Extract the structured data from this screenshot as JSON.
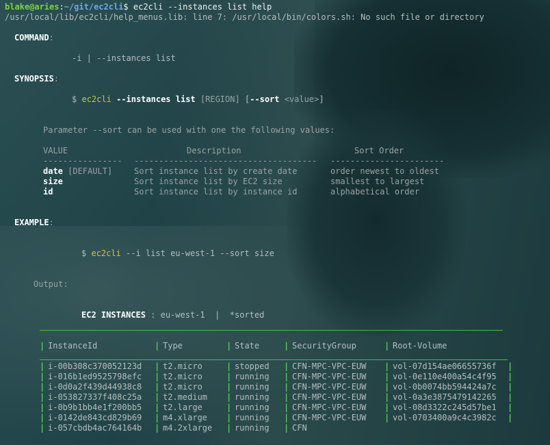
{
  "prompt": {
    "user_host": "blake@aries",
    "path": "~/git/ec2cli",
    "symbol": "$",
    "command": " ec2cli --instances list help"
  },
  "error_line": "/usr/local/lib/ec2cli/help_menus.lib: line 7: /usr/local/bin/colors.sh: No such file or directory",
  "command_section": {
    "heading": "COMMAND",
    "colon": ":",
    "line": "-i | --instances list"
  },
  "synopsis": {
    "heading": "SYNOPSIS",
    "colon": ":",
    "dollar": "$",
    "cmd": "ec2cli",
    "flag": "--instances list",
    "region": "[REGION]",
    "bracket_open": "[",
    "sort_flag": "--sort",
    "value": "<value>",
    "bracket_close": "]"
  },
  "parameter_note": "Parameter --sort can be used with one the following values:",
  "sort_table": {
    "headers": {
      "value": "VALUE",
      "description": "Description",
      "order": "Sort Order"
    },
    "dashes": [
      "----------------",
      "-------------------------------------",
      "-----------------------"
    ],
    "rows": [
      {
        "value": "date",
        "suffix": " [DEFAULT]",
        "description": "Sort instance list by create date",
        "order": "order newest to oldest"
      },
      {
        "value": "size",
        "suffix": "",
        "description": "Sort instance list by EC2 size",
        "order": "smallest to largest"
      },
      {
        "value": "id",
        "suffix": "",
        "description": "Sort instance list by instance id",
        "order": "alphabetical order"
      }
    ]
  },
  "example": {
    "heading": "EXAMPLE",
    "colon": ":",
    "dollar": "$",
    "cmd": "ec2cli",
    "args": " --i list eu-west-1 --sort size"
  },
  "output_label": "Output:",
  "ec2_header": {
    "title": "EC2 INSTANCES",
    "rest": " : eu-west-1  |  *sorted"
  },
  "instances_table": {
    "columns": [
      "InstanceId",
      "Type",
      "State",
      "SecurityGroup",
      "Root-Volume"
    ],
    "rows": [
      [
        "i-00b308c370052123d",
        "t2.micro",
        "stopped",
        "CFN-MPC-VPC-EUW",
        "vol-07d154ae06655736f"
      ],
      [
        "i-016b1ed9525798efc",
        "t2.micro",
        "running",
        "CFN-MPC-VPC-EUW",
        "vol-0e110e400a54c4f95"
      ],
      [
        "i-0d0a2f439d44938c8",
        "t2.micro",
        "running",
        "CFN-MPC-VPC-EUW",
        "vol-0b0074bb594424a7c"
      ],
      [
        "i-053827337f408c25a",
        "t2.medium",
        "running",
        "CFN-MPC-VPC-EUW",
        "vol-0a3e3875479142265"
      ],
      [
        "i-0b9b1bb4e1f200bb5",
        "t2.large",
        "running",
        "CFN-MPC-VPC-EUW",
        "vol-08d3322c245d57be1"
      ],
      [
        "i-0142de843cd829b69",
        "m4.xlarge",
        "running",
        "CFN-MPC-VPC-EUW",
        "vol-0703400a9c4c3982c"
      ],
      [
        "i-057cbdb4ac764164b",
        "m4.2xlarge",
        "running",
        "CFN",
        ""
      ]
    ]
  }
}
